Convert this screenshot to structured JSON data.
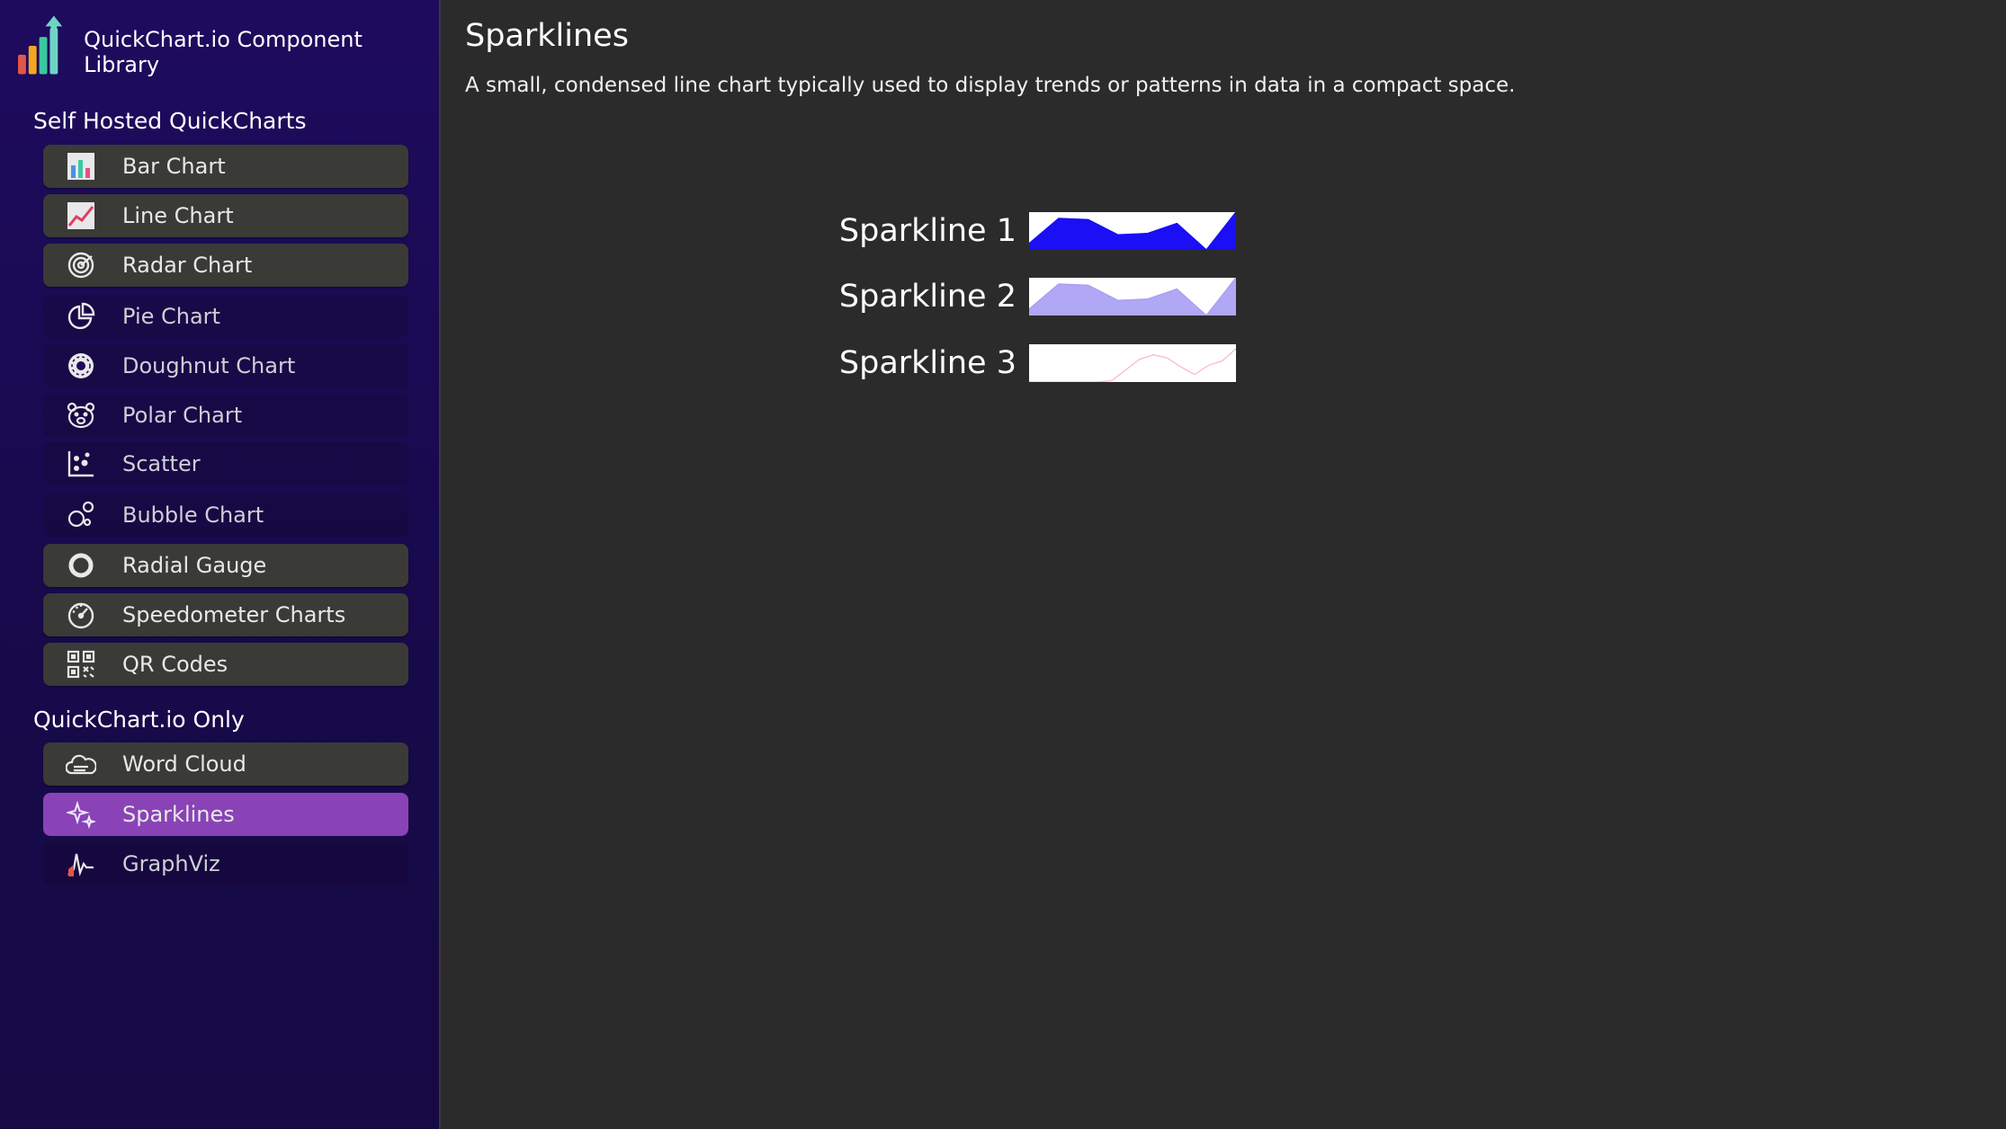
{
  "app": {
    "title": "QuickChart.io Component Library"
  },
  "sidebar": {
    "section_self_hosted": "Self Hosted QuickCharts",
    "section_quickchart_only": "QuickChart.io Only",
    "items": [
      {
        "label": "Bar Chart",
        "icon": "bar-chart-icon"
      },
      {
        "label": "Line Chart",
        "icon": "line-chart-icon"
      },
      {
        "label": "Radar Chart",
        "icon": "radar-icon"
      },
      {
        "label": "Pie Chart",
        "icon": "pie-chart-icon"
      },
      {
        "label": "Doughnut Chart",
        "icon": "doughnut-icon"
      },
      {
        "label": "Polar Chart",
        "icon": "polar-bear-icon"
      },
      {
        "label": "Scatter",
        "icon": "scatter-icon"
      },
      {
        "label": "Bubble Chart",
        "icon": "bubbles-icon"
      },
      {
        "label": "Radial Gauge",
        "icon": "ring-icon"
      },
      {
        "label": "Speedometer Charts",
        "icon": "speedometer-icon"
      },
      {
        "label": "QR Codes",
        "icon": "qr-code-icon"
      },
      {
        "label": "Word Cloud",
        "icon": "cloud-icon"
      },
      {
        "label": "Sparklines",
        "icon": "sparkles-icon"
      },
      {
        "label": "GraphViz",
        "icon": "graphviz-icon"
      }
    ]
  },
  "main": {
    "title": "Sparklines",
    "description": "A small, condensed line chart typically used to display trends or patterns in data in a compact space."
  },
  "chart_data": [
    {
      "type": "area",
      "title": "Sparkline 1",
      "values": [
        5,
        25,
        24,
        12,
        13,
        21,
        0,
        30
      ],
      "ylim": [
        0,
        30
      ],
      "color": "#1a0ff5",
      "fill": "#1a0ff5"
    },
    {
      "type": "area",
      "title": "Sparkline 2",
      "values": [
        5,
        25,
        24,
        12,
        13,
        21,
        0,
        30
      ],
      "ylim": [
        0,
        30
      ],
      "color": "#a9a0f4",
      "fill": "#b0a8f5"
    },
    {
      "type": "line",
      "title": "Sparkline 3",
      "values": [
        0,
        0,
        0,
        0,
        0,
        0,
        1,
        8,
        15,
        18,
        16,
        10,
        5,
        11,
        14,
        22
      ],
      "ylim": [
        0,
        25
      ],
      "color": "#ffb3c0"
    }
  ],
  "colors": {
    "sidebar_bg": "#1e0b5e",
    "active_item": "#8a43b6",
    "button_bg": "#3a3a37",
    "main_bg": "#2b2b2b"
  }
}
